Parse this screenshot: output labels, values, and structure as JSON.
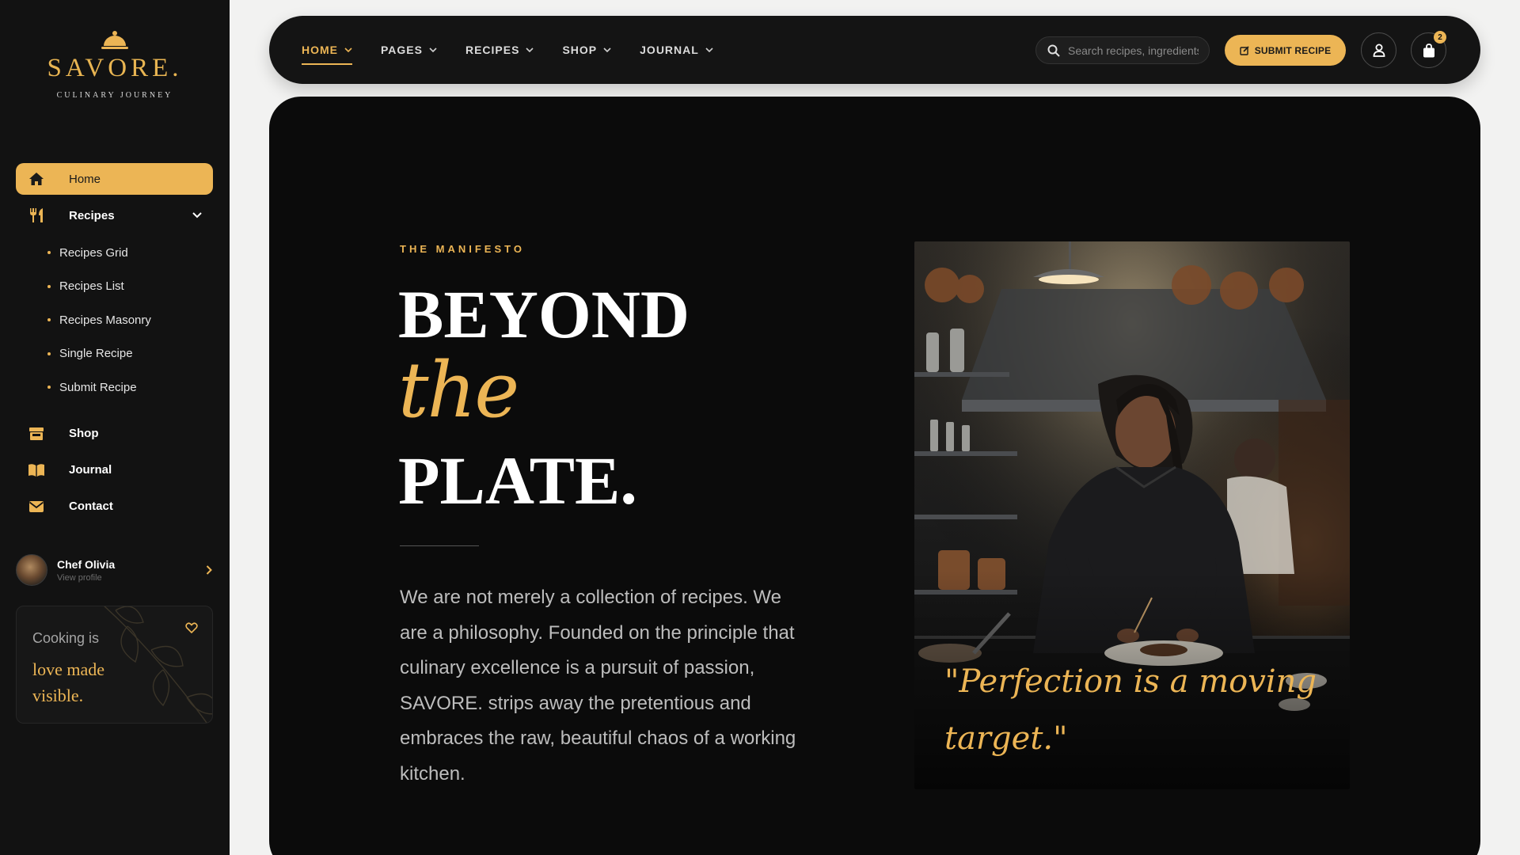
{
  "brand": {
    "name": "SAVORE.",
    "tagline": "CULINARY JOURNEY"
  },
  "sidebar": {
    "items": [
      {
        "label": "Home",
        "icon": "home-icon",
        "active": true
      },
      {
        "label": "Recipes",
        "icon": "utensils-icon",
        "expanded": true,
        "children": [
          "Recipes Grid",
          "Recipes List",
          "Recipes Masonry",
          "Single Recipe",
          "Submit Recipe"
        ]
      },
      {
        "label": "Shop",
        "icon": "store-icon"
      },
      {
        "label": "Journal",
        "icon": "book-icon"
      },
      {
        "label": "Contact",
        "icon": "envelope-icon"
      }
    ],
    "profile": {
      "name": "Chef Olivia",
      "subtitle": "View profile"
    },
    "quote": {
      "line1": "Cooking is",
      "line2": "love made",
      "line3": "visible."
    }
  },
  "topbar": {
    "menu": [
      {
        "label": "HOME",
        "active": true
      },
      {
        "label": "PAGES"
      },
      {
        "label": "RECIPES"
      },
      {
        "label": "SHOP"
      },
      {
        "label": "JOURNAL"
      }
    ],
    "search_placeholder": "Search recipes, ingredients...",
    "submit_label": "SUBMIT RECIPE",
    "cart_count": "2"
  },
  "hero": {
    "eyebrow": "THE MANIFESTO",
    "title_line1": "BEYOND",
    "title_line2": "the",
    "title_line3": "PLATE.",
    "paragraph": "We are not merely a collection of recipes. We are a philosophy. Founded on the principle that culinary excellence is a pursuit of passion, SAVORE. strips away the pretentious and embraces the raw, beautiful chaos of a working kitchen.",
    "image_quote": "\"Perfection is a moving target.\""
  },
  "colors": {
    "accent": "#ecb555",
    "sidebar_bg": "#121212",
    "hero_bg": "#0b0b0b",
    "page_bg": "#f2f2f1"
  }
}
